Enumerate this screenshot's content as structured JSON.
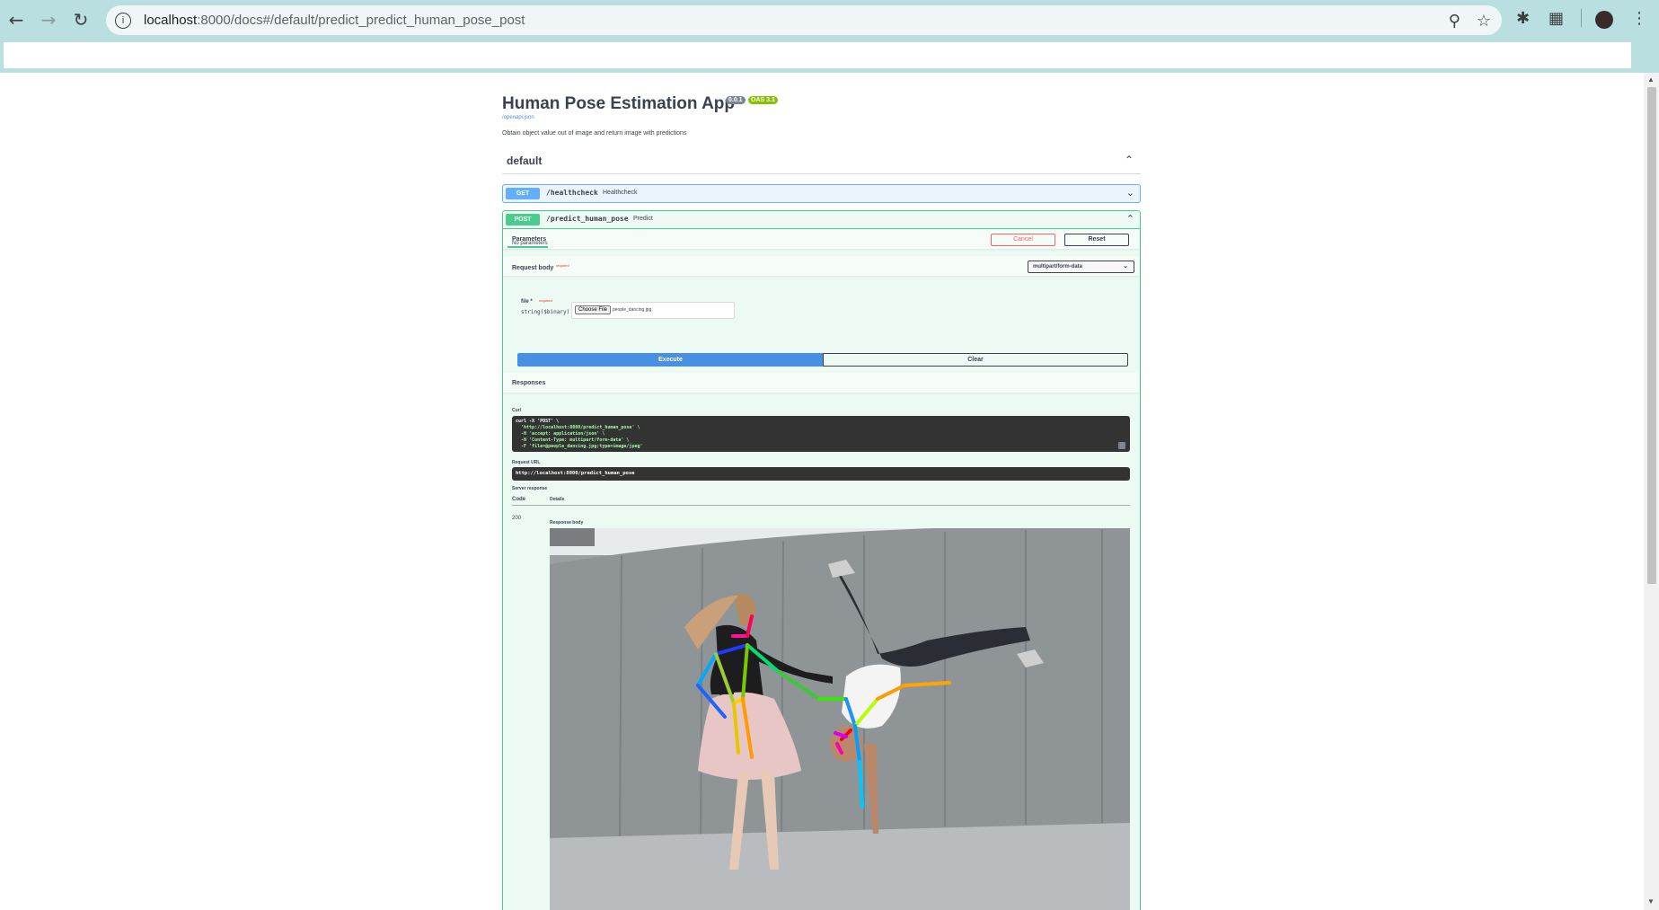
{
  "browser": {
    "url_host": "localhost",
    "url_path": ":8000/docs#/default/predict_predict_human_pose_post"
  },
  "app": {
    "title": "Human Pose Estimation App",
    "version": "0.0.1",
    "oas": "OAS 3.1",
    "openapi_link": "/openapi.json",
    "description": "Obtain object value out of image and return image with predictions"
  },
  "tag": {
    "name": "default"
  },
  "ops": {
    "get": {
      "method": "GET",
      "path": "/healthcheck",
      "summary": "Healthcheck"
    },
    "post": {
      "method": "POST",
      "path": "/predict_human_pose",
      "summary": "Predict"
    }
  },
  "params": {
    "tab": "Parameters",
    "cancel": "Cancel",
    "reset": "Reset",
    "none": "No parameters"
  },
  "request_body": {
    "label": "Request body",
    "required": "required",
    "content_type": "multipart/form-data",
    "file_label": "file *",
    "file_required": "required",
    "file_type": "string($binary)",
    "choose": "Choose File",
    "chosen_file": "people_dancing.jpg"
  },
  "actions": {
    "execute": "Execute",
    "clear": "Clear"
  },
  "responses": {
    "label": "Responses",
    "curl_label": "Curl",
    "curl_lines": [
      "curl -X 'POST' \\",
      "  'http://localhost:8000/predict_human_pose' \\",
      "  -H 'accept: application/json' \\",
      "  -H 'Content-Type: multipart/form-data' \\",
      "  -F 'file=@people_dancing.jpg;type=image/jpeg'"
    ],
    "request_url_label": "Request URL",
    "request_url": "http://localhost:8000/predict_human_pose",
    "server_response": "Server response",
    "code_header": "Code",
    "details_header": "Details",
    "code": "200",
    "response_body": "Response body"
  }
}
